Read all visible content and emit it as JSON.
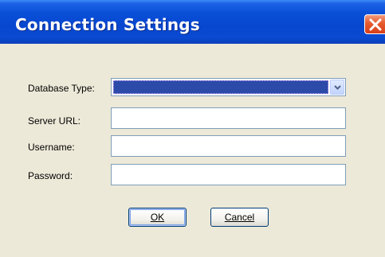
{
  "window": {
    "title": "Connection Settings"
  },
  "form": {
    "database_type": {
      "label": "Database Type:",
      "value": ""
    },
    "server_url": {
      "label": "Server URL:",
      "value": "",
      "placeholder": ""
    },
    "username": {
      "label": "Username:",
      "value": "",
      "placeholder": ""
    },
    "password": {
      "label": "Password:",
      "value": "",
      "placeholder": ""
    }
  },
  "buttons": {
    "ok_label": "OK",
    "cancel_label": "Cancel"
  },
  "colors": {
    "titlebar": "#0747cf",
    "client_background": "#ece9d8",
    "close_button": "#e65a2e",
    "selection_highlight": "#2c4aa8"
  },
  "icons": {
    "close": "close-icon",
    "dropdown": "chevron-down-icon"
  }
}
